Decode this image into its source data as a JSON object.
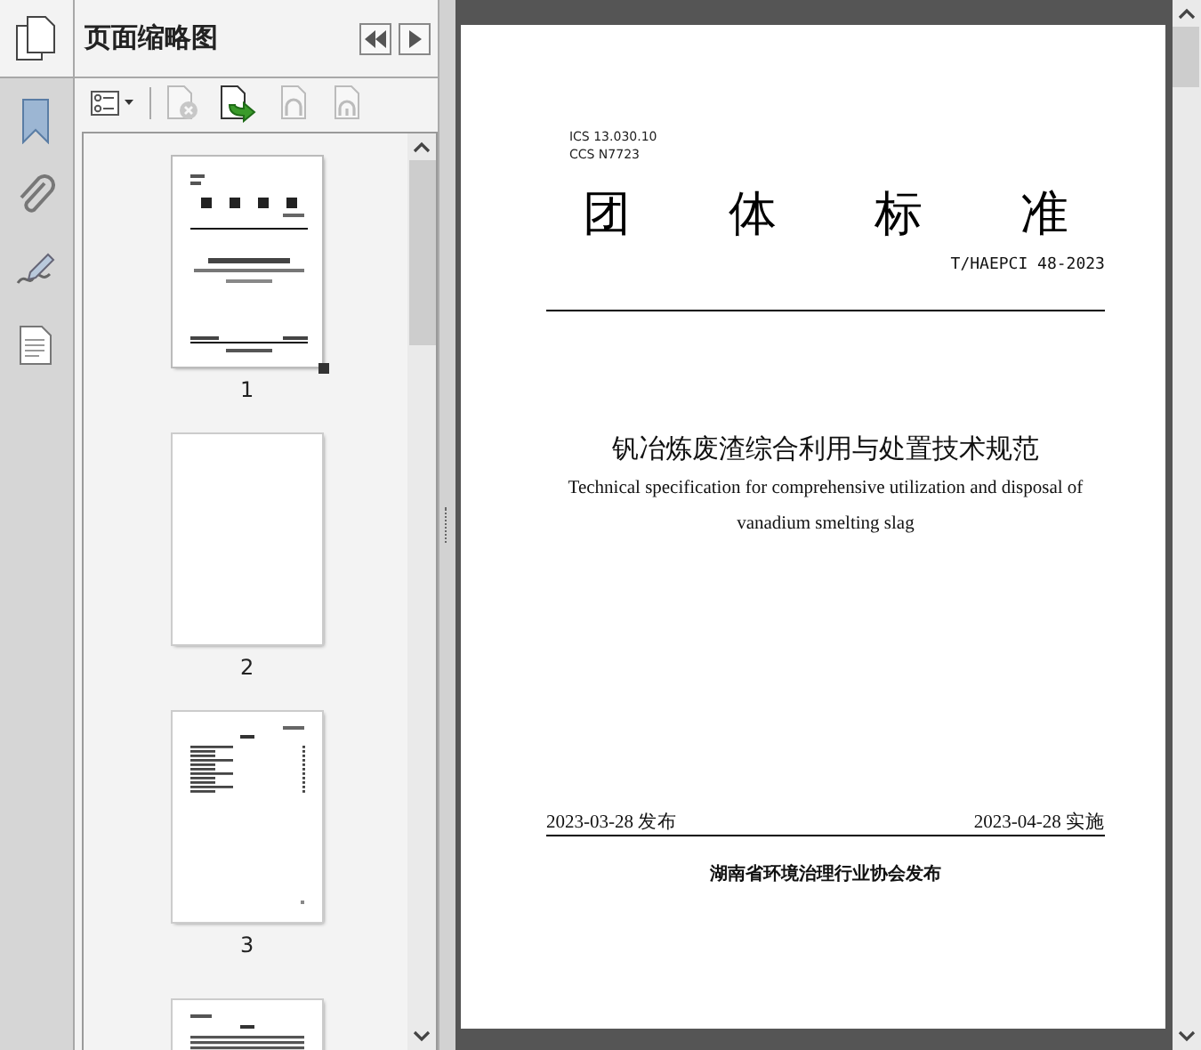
{
  "rail": [
    {
      "kind": "pages",
      "selected": true
    },
    {
      "kind": "bookmark",
      "selected": false
    },
    {
      "kind": "attachment",
      "selected": false
    },
    {
      "kind": "signature",
      "selected": false
    },
    {
      "kind": "layers",
      "selected": false
    }
  ],
  "panel": {
    "title": "页面缩略图"
  },
  "toolbar": [
    {
      "kind": "options",
      "disabled": false
    },
    {
      "kind": "delete",
      "disabled": true
    },
    {
      "kind": "insert",
      "disabled": false
    },
    {
      "kind": "undo",
      "disabled": true
    },
    {
      "kind": "redo",
      "disabled": true
    }
  ],
  "thumbnails": [
    {
      "kind": "cover",
      "label": "1",
      "selected": true
    },
    {
      "kind": "blank",
      "label": "2",
      "selected": false
    },
    {
      "kind": "contents",
      "label": "3",
      "selected": false
    },
    {
      "kind": "text",
      "selected": false
    }
  ],
  "document": {
    "codes": [
      "ICS 13.030.10",
      "CCS N7723"
    ],
    "heading": "团体标准",
    "number": "T/HAEPCI 48-2023",
    "title": "钒冶炼废渣综合利用与处置技术规范",
    "subtitle_lines": [
      "Technical specification for comprehensive utilization and disposal of",
      "vanadium smelting slag"
    ],
    "issue_date": "2023-03-28 发布",
    "effective_date": "2023-04-28 实施",
    "publisher": "湖南省环境治理行业协会发布"
  }
}
